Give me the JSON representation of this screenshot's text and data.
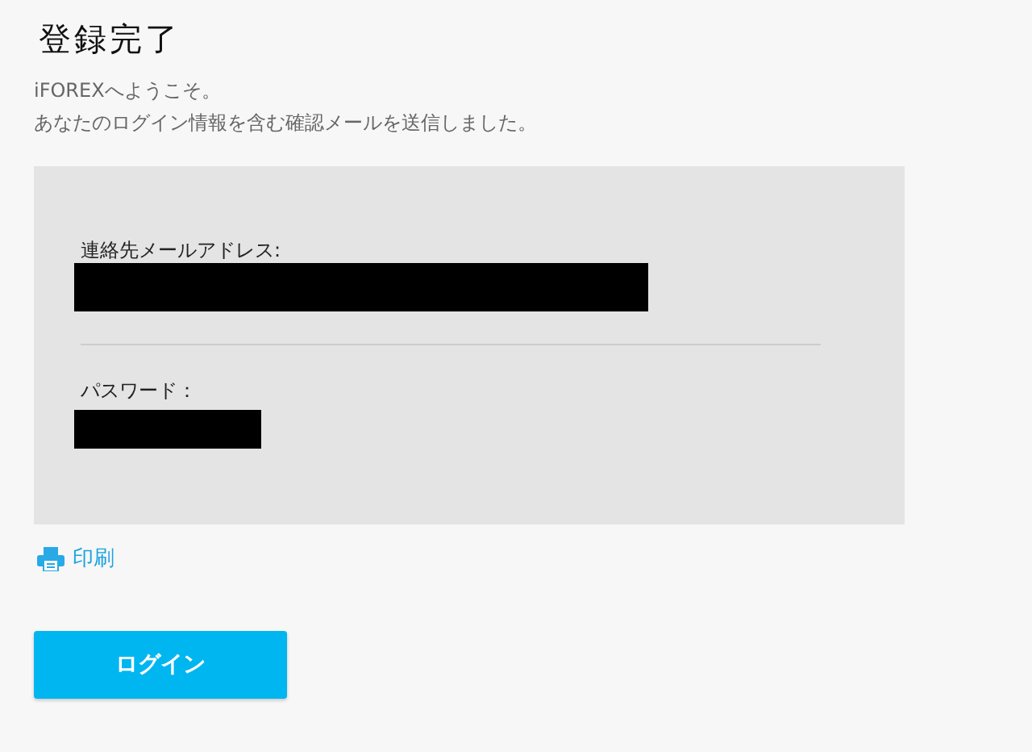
{
  "title": "登録完了",
  "intro": [
    "iFOREXへようこそ。",
    "あなたのログイン情報を含む確認メールを送信しました。"
  ],
  "fields": [
    {
      "label": "連絡先メールアドレス:",
      "kind": "long"
    },
    {
      "label": "パスワード：",
      "kind": "short"
    }
  ],
  "print_link": "印刷",
  "login_button": "ログイン"
}
